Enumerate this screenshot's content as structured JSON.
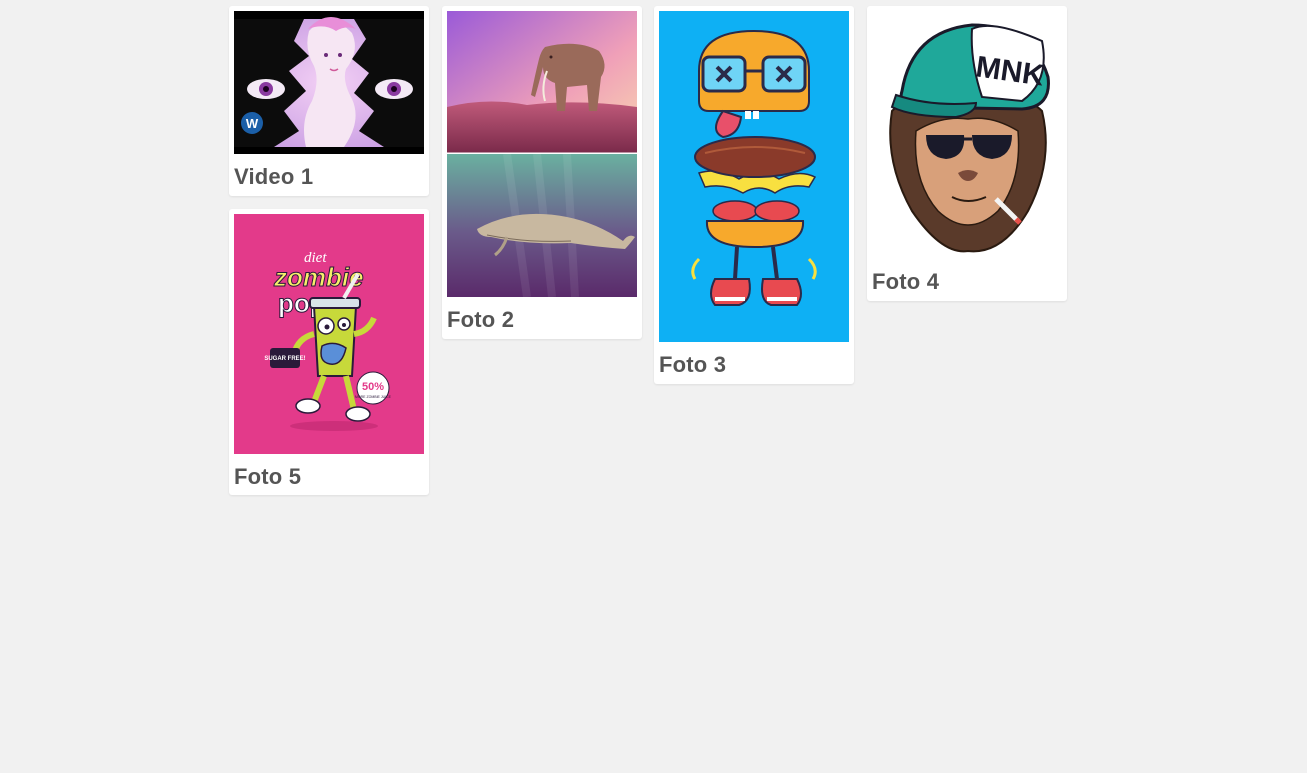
{
  "gallery": {
    "items": [
      {
        "title": "Video 1",
        "type": "video",
        "badge": "W"
      },
      {
        "title": "Foto 2",
        "type": "photo"
      },
      {
        "title": "Foto 3",
        "type": "photo"
      },
      {
        "title": "Foto 4",
        "type": "photo",
        "cap_text": "MNK"
      },
      {
        "title": "Foto 5",
        "type": "photo",
        "art_text": {
          "line1": "diet",
          "line2": "zombie",
          "line3": "pop",
          "tag": "SUGAR FREE!",
          "sticker": "50%",
          "sticker_sub": "MORE ZOMBIE JUICE"
        }
      }
    ]
  },
  "colors": {
    "background": "#f1f1f1",
    "card": "#ffffff",
    "caption": "#555555",
    "foto3_bg": "#0eb0f4",
    "foto5_bg": "#e33a8a"
  }
}
